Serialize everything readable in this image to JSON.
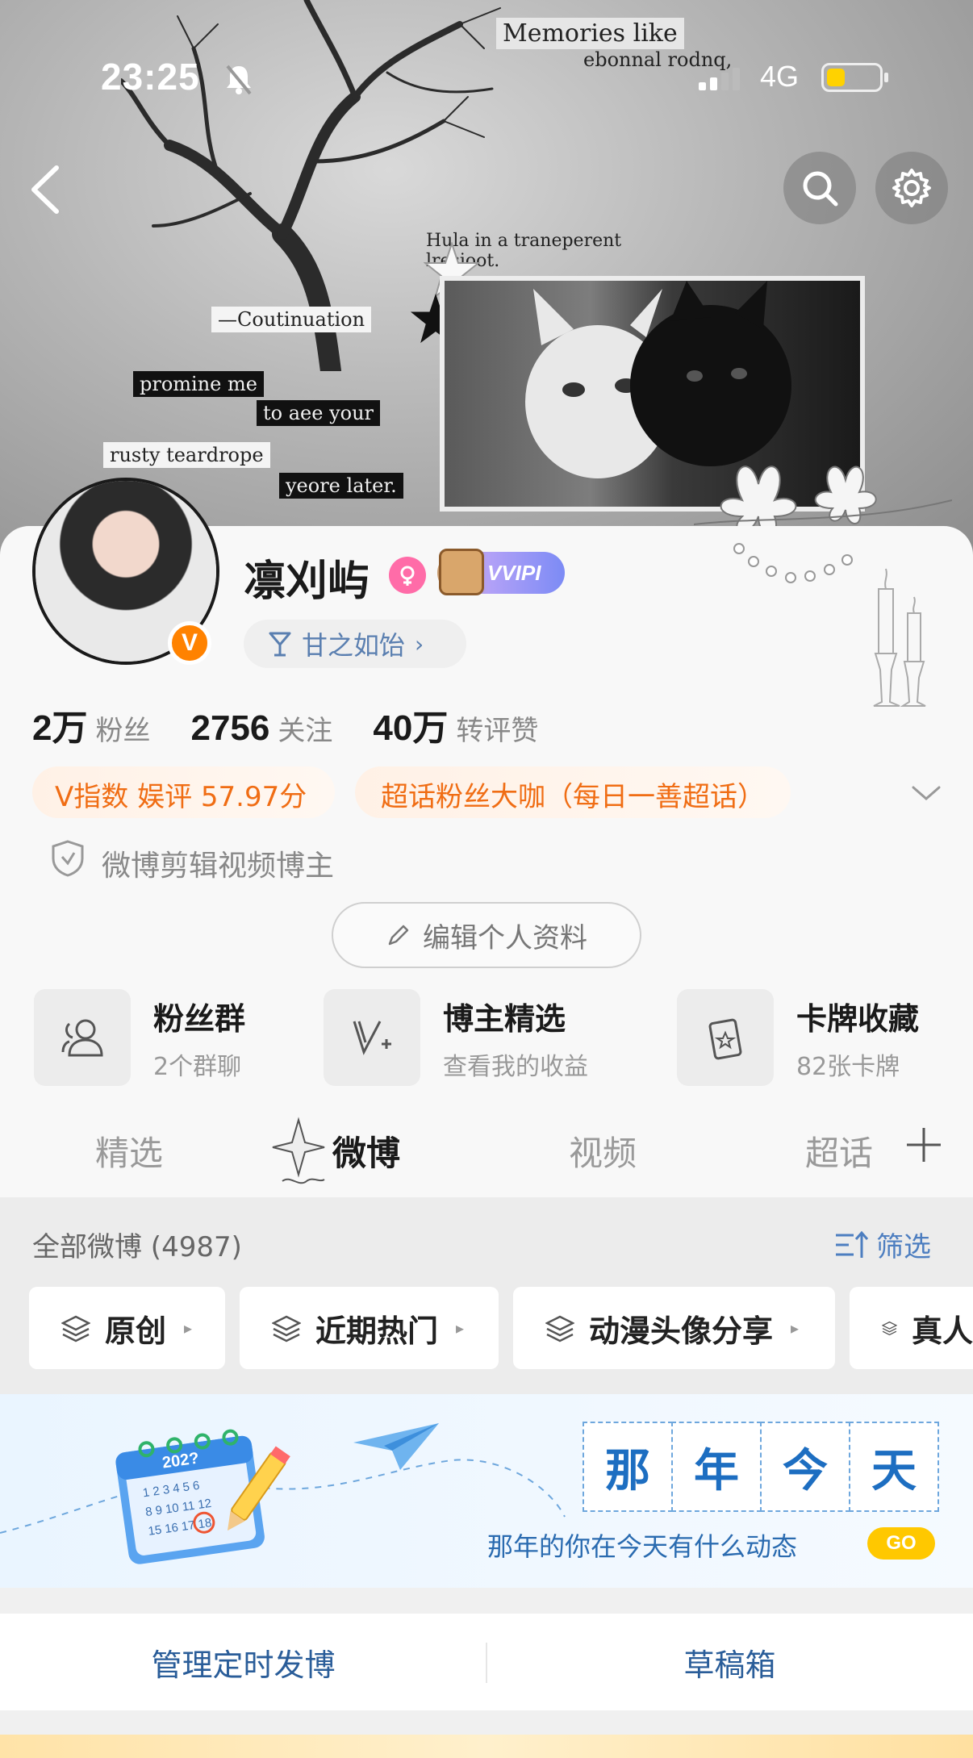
{
  "status_bar": {
    "time": "23:25",
    "network": "4G",
    "battery_level": 0.35
  },
  "cover": {
    "collage_texts": {
      "memories": "Memories like",
      "ebonnal": "ebonnal rodnq,",
      "hula": "Hula in a traneperent\nlresioot.",
      "coutinuation": "—Coutinuation",
      "promise": "promine me",
      "to_aee": "to aee your",
      "rusty": "rusty teardrope",
      "yeore": "yeore later."
    }
  },
  "profile": {
    "name": "凛刈屿",
    "vip_label": "VVIPI",
    "title_pill": "甘之如饴",
    "avatar_badge": "V",
    "stats": [
      {
        "value": "2万",
        "label": "粉丝"
      },
      {
        "value": "2756",
        "label": "关注"
      },
      {
        "value": "40万",
        "label": "转评赞"
      }
    ],
    "v_index": "V指数 娱评 57.97分",
    "chaohua": "超话粉丝大咖（每日一善超话）",
    "auth": "微博剪辑视频博主",
    "edit_button": "编辑个人资料",
    "tiles": [
      {
        "title": "粉丝群",
        "subtitle": "2个群聊",
        "icon": "fans-group-icon"
      },
      {
        "title": "博主精选",
        "subtitle": "查看我的收益",
        "icon": "blogger-select-icon"
      },
      {
        "title": "卡牌收藏",
        "subtitle": "82张卡牌",
        "icon": "card-collection-icon"
      }
    ]
  },
  "tabs": [
    {
      "label": "精选",
      "active": false
    },
    {
      "label": "微博",
      "active": true
    },
    {
      "label": "视频",
      "active": false
    },
    {
      "label": "超话",
      "active": false
    }
  ],
  "feed": {
    "all_weibo": "全部微博 (4987)",
    "filter": "筛选",
    "chips": [
      "原创",
      "近期热门",
      "动漫头像分享",
      "真人"
    ]
  },
  "banner": {
    "chars": [
      "那",
      "年",
      "今",
      "天"
    ],
    "calendar_year": "202?",
    "subtitle": "那年的你在今天有什么动态",
    "go": "GO"
  },
  "bottom": {
    "scheduled": "管理定时发博",
    "drafts": "草稿箱"
  },
  "colors": {
    "accent_orange": "#ff8200",
    "link_blue": "#4d7ec0",
    "vindex_orange": "#f06d14"
  }
}
